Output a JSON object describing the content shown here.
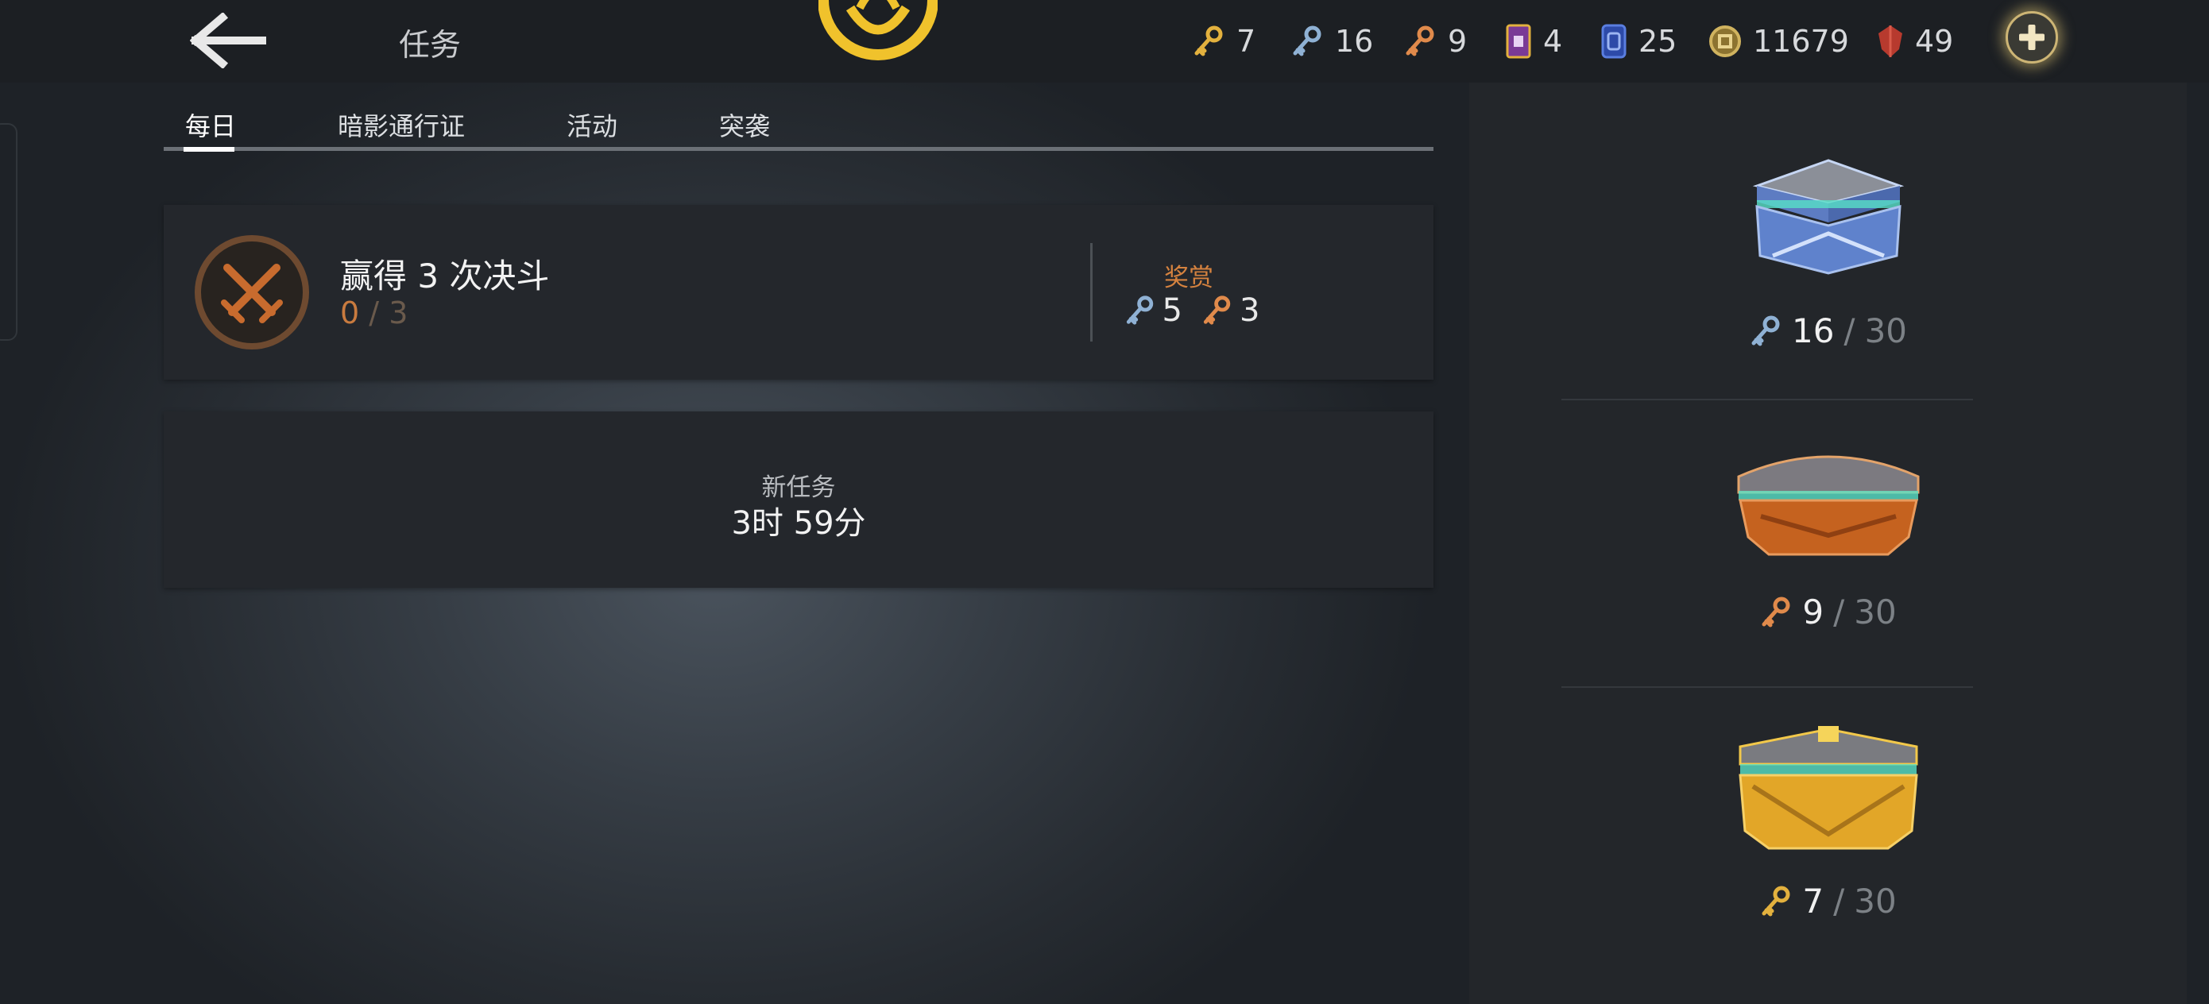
{
  "header": {
    "title": "任务",
    "currencies": [
      {
        "icon": "gold-key-icon",
        "value": "7",
        "color": "#e3b13e"
      },
      {
        "icon": "silver-key-icon",
        "value": "16",
        "color": "#8fb1d4"
      },
      {
        "icon": "bronze-key-icon",
        "value": "9",
        "color": "#e08a4b"
      },
      {
        "icon": "ticket-icon",
        "value": "4",
        "color": "#b06fd0"
      },
      {
        "icon": "card-icon",
        "value": "25",
        "color": "#3e63c7"
      },
      {
        "icon": "coin-icon",
        "value": "11679",
        "color": "#d0b35f"
      },
      {
        "icon": "gem-icon",
        "value": "49",
        "color": "#b73a2e"
      }
    ]
  },
  "tabs": [
    {
      "label": "每日",
      "active": true
    },
    {
      "label": "暗影通行证",
      "active": false
    },
    {
      "label": "活动",
      "active": false
    },
    {
      "label": "突袭",
      "active": false
    }
  ],
  "quest": {
    "icon": "crossed-swords-icon",
    "title": "赢得 3 次决斗",
    "progress_current": "0",
    "progress_sep": "/",
    "progress_total": "3",
    "reward_label": "奖赏",
    "rewards": [
      {
        "icon": "silver-key-icon",
        "value": "5"
      },
      {
        "icon": "bronze-key-icon",
        "value": "3"
      }
    ]
  },
  "new_task": {
    "label": "新任务",
    "timer": "3时 59分"
  },
  "chests": [
    {
      "icon": "silver-chest-icon",
      "key_icon": "silver-key-icon",
      "current": "16",
      "sep": "/",
      "max": "30",
      "color": "#6b8dcf"
    },
    {
      "icon": "bronze-chest-icon",
      "key_icon": "bronze-key-icon",
      "current": "9",
      "sep": "/",
      "max": "30",
      "color": "#c5621f"
    },
    {
      "icon": "gold-chest-icon",
      "key_icon": "gold-key-icon",
      "current": "7",
      "sep": "/",
      "max": "30",
      "color": "#e2a628"
    }
  ]
}
